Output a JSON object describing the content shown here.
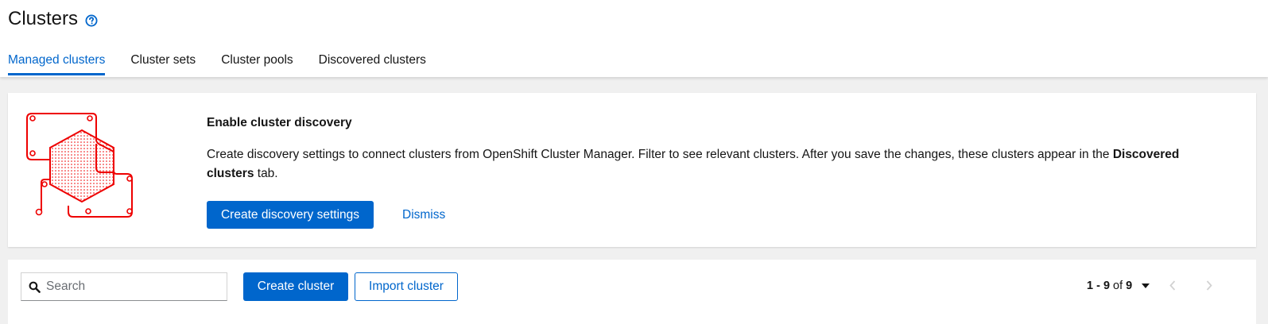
{
  "header": {
    "title": "Clusters",
    "help_icon": "help-circle-icon",
    "tabs": [
      {
        "label": "Managed clusters",
        "active": true
      },
      {
        "label": "Cluster sets",
        "active": false
      },
      {
        "label": "Cluster pools",
        "active": false
      },
      {
        "label": "Discovered clusters",
        "active": false
      }
    ]
  },
  "discovery_card": {
    "illustration": "cluster-discovery-illustration",
    "title": "Enable cluster discovery",
    "body_text": "Create discovery settings to connect clusters from OpenShift Cluster Manager. Filter to see relevant clusters. After you save the changes, these clusters appear in the ",
    "body_bold": "Discovered clusters",
    "body_suffix": " tab.",
    "primary_button": "Create discovery settings",
    "dismiss_link": "Dismiss"
  },
  "toolbar": {
    "search_placeholder": "Search",
    "search_value": "",
    "create_button": "Create cluster",
    "import_button": "Import cluster",
    "pagination": {
      "range": "1 - 9",
      "of_label": "of",
      "total": "9"
    }
  },
  "colors": {
    "primary": "#0066cc",
    "illustration_red": "#ee0000",
    "background": "#f0f0f0"
  }
}
